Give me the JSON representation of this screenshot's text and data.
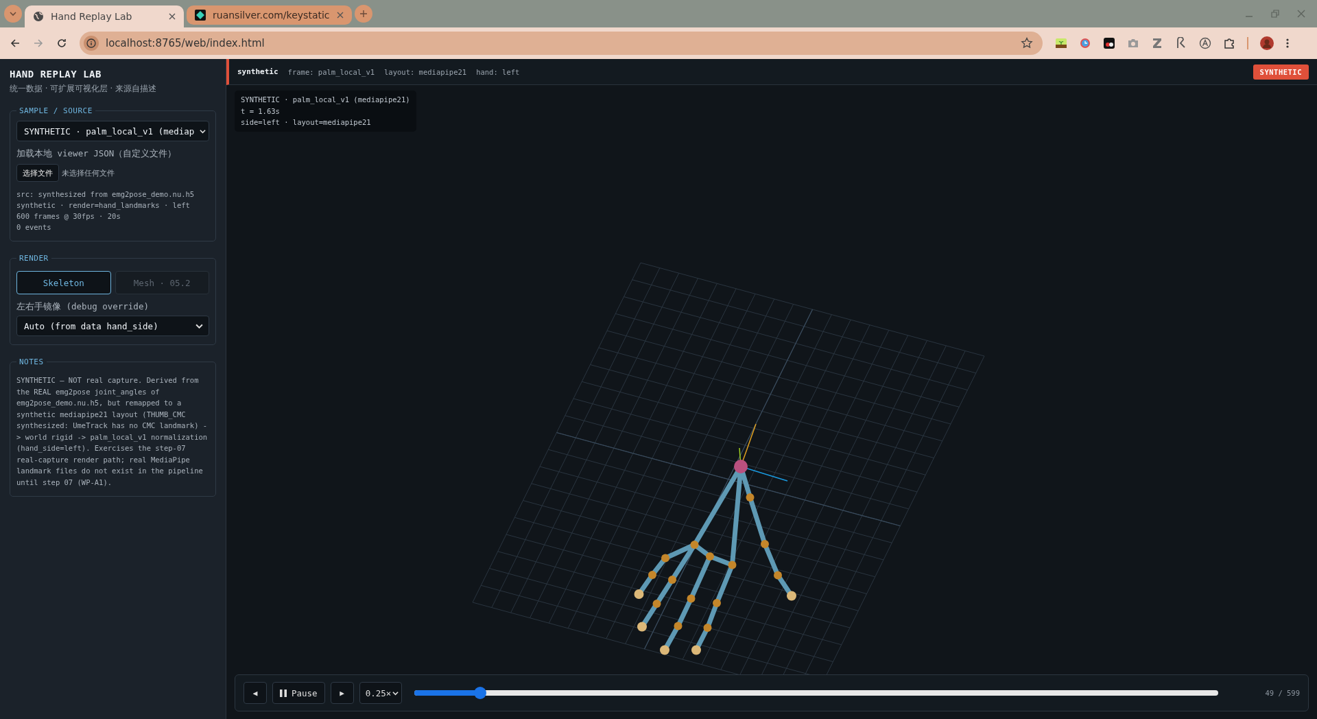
{
  "browser": {
    "tabs": [
      {
        "title": "Hand Replay Lab",
        "selected": true
      },
      {
        "title": "ruansilver.com/keystatic",
        "selected": false
      }
    ],
    "url": "localhost:8765/web/index.html"
  },
  "sidebar": {
    "title": "HAND REPLAY LAB",
    "subtitle": "统一数据 · 可扩展可视化层 · 来源自描述",
    "sample": {
      "legend": "SAMPLE / SOURCE",
      "select": "SYNTHETIC · palm_local_v1 (mediap",
      "load_label": "加载本地 viewer JSON（自定义文件）",
      "file_button": "选择文件",
      "file_status": "未选择任何文件",
      "info": [
        "src: synthesized from emg2pose_demo.nu.h5",
        "synthetic · render=hand_landmarks · left",
        "600 frames @ 30fps · 20s",
        "0 events"
      ]
    },
    "render": {
      "legend": "RENDER",
      "modes": [
        {
          "label": "Skeleton",
          "selected": true
        },
        {
          "label": "Mesh · 05.2",
          "selected": false
        }
      ],
      "mirror_label": "左右手镜像 (debug override)",
      "mirror_select": "Auto (from data hand_side)"
    },
    "notes": {
      "legend": "NOTES",
      "text": "SYNTHETIC — NOT real capture. Derived from the REAL emg2pose joint_angles of emg2pose_demo.nu.h5, but remapped to a synthetic mediapipe21 layout (THUMB_CMC synthesized: UmeTrack has no CMC landmark) -> world rigid -> palm_local_v1 normalization (hand_side=left). Exercises the step-07 real-capture render path; real MediaPipe landmark files do not exist in the pipeline until step 07 (WP-A1)."
    }
  },
  "header": {
    "source": "synthetic",
    "meta": [
      "frame: palm_local_v1",
      "layout: mediapipe21",
      "hand: left"
    ],
    "badge": "SYNTHETIC"
  },
  "overlay": {
    "lines": [
      "SYNTHETIC · palm_local_v1 (mediapipe21)",
      "t = 1.63s",
      "side=left · layout=mediapipe21"
    ]
  },
  "playback": {
    "prev": "◀",
    "pause": "Pause",
    "next": "▶",
    "speed": "0.25×",
    "level": 0.082,
    "counter": "49 / 599"
  }
}
